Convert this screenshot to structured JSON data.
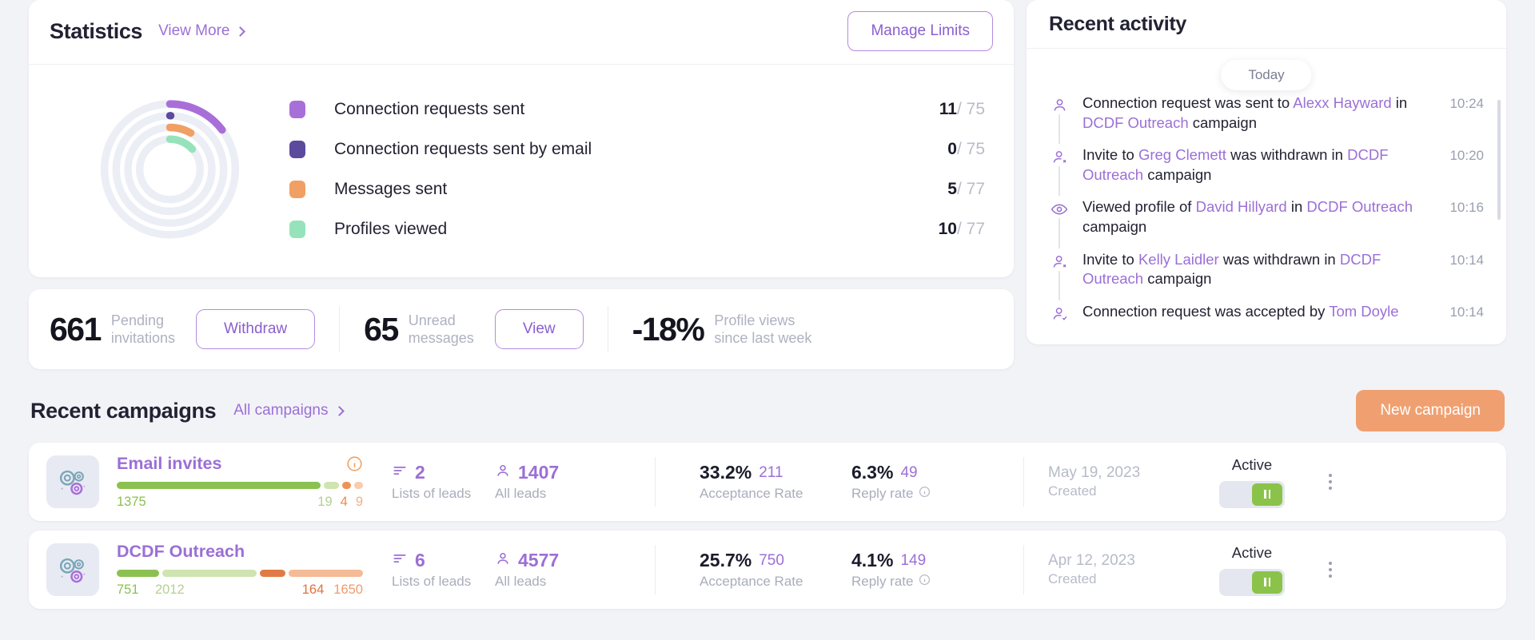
{
  "statistics": {
    "title": "Statistics",
    "view_more": "View More",
    "manage_limits": "Manage Limits",
    "legend": [
      {
        "label": "Connection requests sent",
        "value": "11",
        "sep": "/",
        "limit": "75",
        "color": "#a96fd8"
      },
      {
        "label": "Connection requests sent by email",
        "value": "0",
        "sep": "/",
        "limit": "75",
        "color": "#5b4a9e"
      },
      {
        "label": "Messages sent",
        "value": "5",
        "sep": "/",
        "limit": "77",
        "color": "#f0a064"
      },
      {
        "label": "Profiles viewed",
        "value": "10",
        "sep": "/",
        "limit": "77",
        "color": "#96e3bb"
      }
    ]
  },
  "chart_data": {
    "type": "pie",
    "title": "Statistics",
    "legend_position": "right",
    "series": [
      {
        "name": "Connection requests sent",
        "value": 11,
        "max": 75,
        "ring": 1,
        "color": "#a96fd8"
      },
      {
        "name": "Connection requests sent by email",
        "value": 0,
        "max": 75,
        "ring": 2,
        "color": "#5b4a9e"
      },
      {
        "name": "Messages sent",
        "value": 5,
        "max": 77,
        "ring": 3,
        "color": "#f0a064"
      },
      {
        "name": "Profiles viewed",
        "value": 10,
        "max": 77,
        "ring": 4,
        "color": "#96e3bb"
      }
    ]
  },
  "kpis": [
    {
      "number": "661",
      "label_line1": "Pending",
      "label_line2": "invitations",
      "action": "Withdraw"
    },
    {
      "number": "65",
      "label_line1": "Unread",
      "label_line2": "messages",
      "action": "View"
    },
    {
      "number": "-18%",
      "label_line1": "Profile views",
      "label_line2": "since last week",
      "action": ""
    }
  ],
  "activity": {
    "title": "Recent activity",
    "today": "Today",
    "items": [
      {
        "icon": "person-icon",
        "parts": [
          {
            "t": "Connection request was sent to ",
            "link": false
          },
          {
            "t": "Alexx Hayward",
            "link": true
          },
          {
            "t": " in ",
            "link": false
          },
          {
            "t": "DCDF Outreach",
            "link": true
          },
          {
            "t": " campaign",
            "link": false
          }
        ],
        "time": "10:24"
      },
      {
        "icon": "person-remove-icon",
        "parts": [
          {
            "t": "Invite to ",
            "link": false
          },
          {
            "t": "Greg Clemett",
            "link": true
          },
          {
            "t": " was withdrawn in ",
            "link": false
          },
          {
            "t": "DCDF Outreach",
            "link": true
          },
          {
            "t": " campaign",
            "link": false
          }
        ],
        "time": "10:20"
      },
      {
        "icon": "eye-icon",
        "parts": [
          {
            "t": "Viewed profile of ",
            "link": false
          },
          {
            "t": "David Hillyard",
            "link": true
          },
          {
            "t": " in ",
            "link": false
          },
          {
            "t": "DCDF Outreach",
            "link": true
          },
          {
            "t": " campaign",
            "link": false
          }
        ],
        "time": "10:16"
      },
      {
        "icon": "person-remove-icon",
        "parts": [
          {
            "t": "Invite to ",
            "link": false
          },
          {
            "t": "Kelly Laidler",
            "link": true
          },
          {
            "t": " was withdrawn in ",
            "link": false
          },
          {
            "t": "DCDF Outreach",
            "link": true
          },
          {
            "t": " campaign",
            "link": false
          }
        ],
        "time": "10:14"
      },
      {
        "icon": "person-accepted-icon",
        "parts": [
          {
            "t": "Connection request was accepted by ",
            "link": false
          },
          {
            "t": "Tom Doyle",
            "link": true
          }
        ],
        "time": "10:14"
      }
    ]
  },
  "campaigns_section": {
    "title": "Recent campaigns",
    "all_campaigns": "All campaigns",
    "new_campaign": "New campaign",
    "labels": {
      "lists_of_leads": "Lists of leads",
      "all_leads": "All leads",
      "acceptance_rate": "Acceptance Rate",
      "reply_rate": "Reply rate",
      "created": "Created"
    },
    "rows": [
      {
        "name": "Email invites",
        "segments": [
          {
            "value": "1375",
            "color": "#8cc152",
            "text_color": "#8cc152",
            "pct": 68
          },
          {
            "value": "19",
            "color": "#cfe4b0",
            "text_color": "#b5cf94",
            "pct": 5
          },
          {
            "value": "4",
            "color": "#ef9256",
            "text_color": "#ef8a4c",
            "pct": 3
          },
          {
            "value": "9",
            "color": "#f7cdae",
            "text_color": "#f0b08a",
            "pct": 3
          }
        ],
        "lists_of_leads": "2",
        "all_leads": "1407",
        "acceptance_pct": "33.2%",
        "acceptance_count": "211",
        "reply_pct": "6.3%",
        "reply_count": "49",
        "date": "May 19, 2023",
        "status": "Active",
        "toggle_on": true
      },
      {
        "name": "DCDF Outreach",
        "segments": [
          {
            "value": "751",
            "color": "#8cc152",
            "text_color": "#8cc152",
            "pct": 17
          },
          {
            "value": "2012",
            "color": "#cfe4b0",
            "text_color": "#b5cf94",
            "pct": 38
          },
          {
            "value": "164",
            "color": "#e07b46",
            "text_color": "#e0713c",
            "pct": 10
          },
          {
            "value": "1650",
            "color": "#f4bb97",
            "text_color": "#ef9a6e",
            "pct": 30
          }
        ],
        "lists_of_leads": "6",
        "all_leads": "4577",
        "acceptance_pct": "25.7%",
        "acceptance_count": "750",
        "reply_pct": "4.1%",
        "reply_count": "149",
        "date": "Apr 12, 2023",
        "status": "Active",
        "toggle_on": true
      }
    ]
  }
}
